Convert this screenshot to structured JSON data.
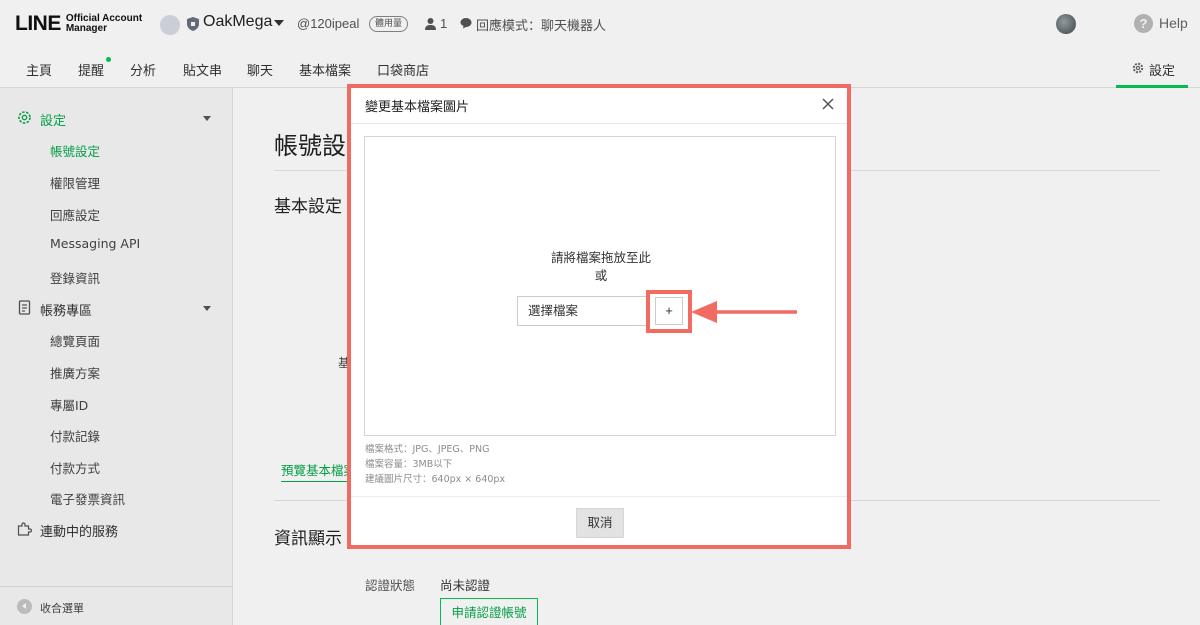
{
  "header": {
    "logo_main": "LINE",
    "logo_sub_line1": "Official Account",
    "logo_sub_line2": "Manager",
    "account_name": "OakMega",
    "account_id": "@120ipeal",
    "trial_badge": "體用量",
    "friends_count": "1",
    "chat_mode": "回應模式：聊天機器人",
    "help_label": "Help"
  },
  "nav": {
    "tabs": [
      "主頁",
      "提醒",
      "分析",
      "貼文串",
      "聊天",
      "基本檔案",
      "口袋商店"
    ],
    "settings_label": "設定",
    "accent_color": "#06c755"
  },
  "sidebar": {
    "groups": [
      {
        "label": "設定",
        "items": [
          "帳號設定",
          "權限管理",
          "回應設定",
          "Messaging API",
          "登錄資訊"
        ]
      },
      {
        "label": "帳務專區",
        "items": [
          "總覽頁面",
          "推廣方案",
          "專屬ID",
          "付款記錄",
          "付款方式",
          "電子發票資訊"
        ]
      },
      {
        "label": "連動中的服務",
        "items": []
      }
    ],
    "active_item": "帳號設定",
    "collapse_label": "收合選單"
  },
  "main": {
    "page_title": "帳號設",
    "basic_section": "基本設定",
    "row_label_fragment": "基",
    "preview_link": "預覽基本檔案",
    "info_section": "資訊顯示",
    "cert_label": "認證狀態",
    "cert_value": "尚未認證",
    "apply_cert_button": "申請認證帳號"
  },
  "modal": {
    "title": "變更基本檔案圖片",
    "drop_text": "請將檔案拖放至此",
    "drop_or": "或",
    "file_input_placeholder": "選擇檔案",
    "plus_label": "+",
    "notes": [
      "檔案格式：JPG、JPEG、PNG",
      "檔案容量：3MB以下",
      "建議圖片尺寸：640px × 640px"
    ],
    "cancel_label": "取消",
    "highlight_color": "#f26b62"
  }
}
